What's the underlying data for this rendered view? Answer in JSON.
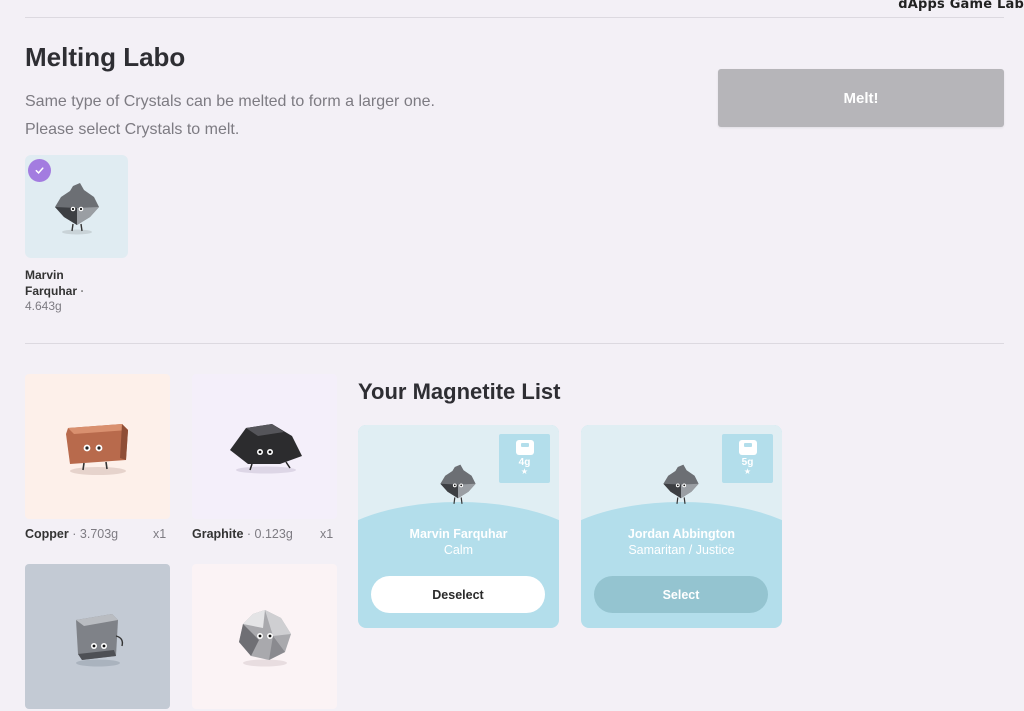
{
  "watermark": "dApps Game Lab",
  "header": {
    "title": "Melting Labo",
    "description_line1": "Same type of Crystals can be melted to form a larger one.",
    "description_line2": "Please select Crystals to melt.",
    "melt_button": "Melt!"
  },
  "selected": {
    "name_line1": "Marvin",
    "name_line2": "Farquhar",
    "separator": "·",
    "weight": "4.643g",
    "check_icon": "check-icon"
  },
  "inventory": [
    {
      "name": "Copper",
      "separator": "·",
      "weight": "3.703g",
      "qty": "x1",
      "tile_color": "#fdf0ea"
    },
    {
      "name": "Graphite",
      "separator": "·",
      "weight": "0.123g",
      "qty": "x1",
      "tile_color": "#f4effa"
    },
    {
      "name": "",
      "weight": "",
      "qty": "",
      "tile_color": "#c3cad4"
    },
    {
      "name": "",
      "weight": "",
      "qty": "",
      "tile_color": "#fbf3f5"
    }
  ],
  "magnetite_list": {
    "title": "Your Magnetite List",
    "cards": [
      {
        "name": "Marvin Farquhar",
        "trait": "Calm",
        "weight": "4g",
        "stars": "★",
        "button": "Deselect",
        "selected": true
      },
      {
        "name": "Jordan Abbington",
        "trait": "Samaritan / Justice",
        "weight": "5g",
        "stars": "★",
        "button": "Select",
        "selected": false
      }
    ]
  },
  "colors": {
    "accent_check": "#a37ce0",
    "card_blue": "#b3deeb",
    "melt_disabled": "#b6b5b9"
  }
}
